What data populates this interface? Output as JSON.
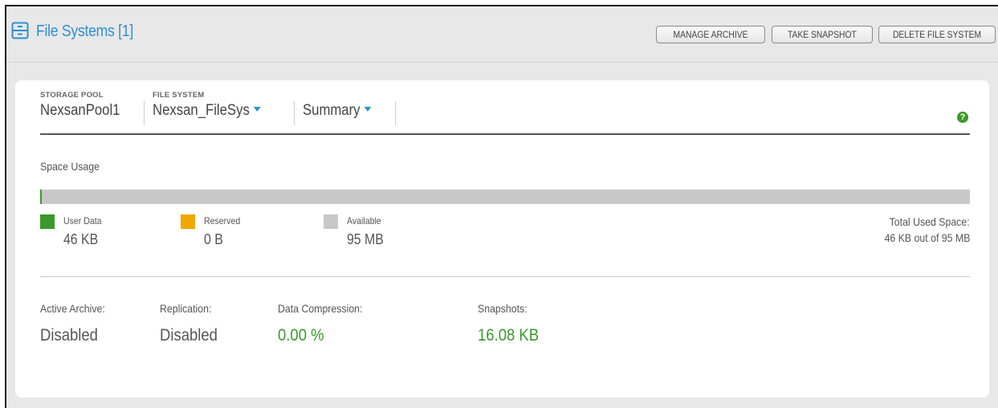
{
  "header": {
    "title": "File Systems [1]",
    "buttons": {
      "manage_archive": "MANAGE ARCHIVE",
      "take_snapshot": "TAKE SNAPSHOT",
      "delete_file_system": "DELETE FILE SYSTEM"
    },
    "icon": "file-cabinet-icon"
  },
  "selector": {
    "storage_pool": {
      "label": "STORAGE POOL",
      "value": "NexsanPool1"
    },
    "file_system": {
      "label": "FILE SYSTEM",
      "value": "Nexsan_FileSys"
    },
    "view": {
      "value": "Summary"
    },
    "help": "?"
  },
  "space_usage": {
    "title": "Space Usage",
    "bar": {
      "used_fraction": 0.0005,
      "reserved_fraction": 0.0
    },
    "legend": [
      {
        "label": "User Data",
        "value": "46 KB",
        "color": "#3a9a2a"
      },
      {
        "label": "Reserved",
        "value": "0 B",
        "color": "#f0a800"
      },
      {
        "label": "Available",
        "value": "95 MB",
        "color": "#c8c8c8"
      }
    ],
    "total": {
      "label": "Total Used Space:",
      "value": "46 KB out of 95 MB"
    }
  },
  "stats": [
    {
      "label": "Active Archive:",
      "value": "Disabled"
    },
    {
      "label": "Replication:",
      "value": "Disabled"
    },
    {
      "label": "Data Compression:",
      "value": "0.00 %"
    },
    {
      "label": "Snapshots:",
      "value": "16.08 KB"
    }
  ],
  "colors": {
    "accent": "#2d8fd5",
    "green": "#3a9a2a",
    "reserved": "#f0a800",
    "available": "#c8c8c8"
  }
}
